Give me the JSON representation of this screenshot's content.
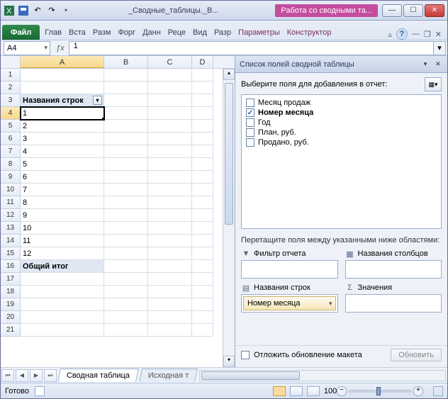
{
  "title": {
    "doc": "_Сводные_таблицы._В...",
    "context": "Работа со сводными та..."
  },
  "qat_icons": [
    "excel",
    "save",
    "undo",
    "redo",
    "dropdown",
    "print",
    "sep",
    "doc"
  ],
  "ribbon": {
    "file": "Файл",
    "tabs": [
      "Глав",
      "Вста",
      "Разм",
      "Форг",
      "Данн",
      "Реце",
      "Вид",
      "Разр"
    ],
    "context_tabs": [
      "Параметры",
      "Конструктор"
    ]
  },
  "namebox": "A4",
  "formula": "1",
  "columns": [
    "A",
    "B",
    "C",
    "D"
  ],
  "rows": [
    {
      "n": 1,
      "A": ""
    },
    {
      "n": 2,
      "A": ""
    },
    {
      "n": 3,
      "A": "Названия строк",
      "header": true
    },
    {
      "n": 4,
      "A": "1",
      "active": true
    },
    {
      "n": 5,
      "A": "2"
    },
    {
      "n": 6,
      "A": "3"
    },
    {
      "n": 7,
      "A": "4"
    },
    {
      "n": 8,
      "A": "5"
    },
    {
      "n": 9,
      "A": "6"
    },
    {
      "n": 10,
      "A": "7"
    },
    {
      "n": 11,
      "A": "8"
    },
    {
      "n": 12,
      "A": "9"
    },
    {
      "n": 13,
      "A": "10"
    },
    {
      "n": 14,
      "A": "11"
    },
    {
      "n": 15,
      "A": "12"
    },
    {
      "n": 16,
      "A": "Общий итог",
      "total": true
    },
    {
      "n": 17,
      "A": ""
    },
    {
      "n": 18,
      "A": ""
    },
    {
      "n": 19,
      "A": ""
    },
    {
      "n": 20,
      "A": ""
    },
    {
      "n": 21,
      "A": ""
    }
  ],
  "sheets": {
    "active": "Сводная таблица",
    "other": "Исходная т"
  },
  "status": {
    "ready": "Готово",
    "zoom": "100%"
  },
  "pane": {
    "title": "Список полей сводной таблицы",
    "choose": "Выберите поля для добавления в отчет:",
    "fields": [
      {
        "label": "Месяц продаж",
        "checked": false
      },
      {
        "label": "Номер месяца",
        "checked": true
      },
      {
        "label": "Год",
        "checked": false
      },
      {
        "label": "План, руб.",
        "checked": false
      },
      {
        "label": "Продано, руб.",
        "checked": false
      }
    ],
    "drag": "Перетащите поля между указанными ниже областями:",
    "areas": {
      "filter": "Фильтр отчета",
      "cols": "Названия столбцов",
      "rows": "Названия строк",
      "vals": "Значения",
      "row_item": "Номер месяца"
    },
    "defer": "Отложить обновление макета",
    "update": "Обновить"
  }
}
